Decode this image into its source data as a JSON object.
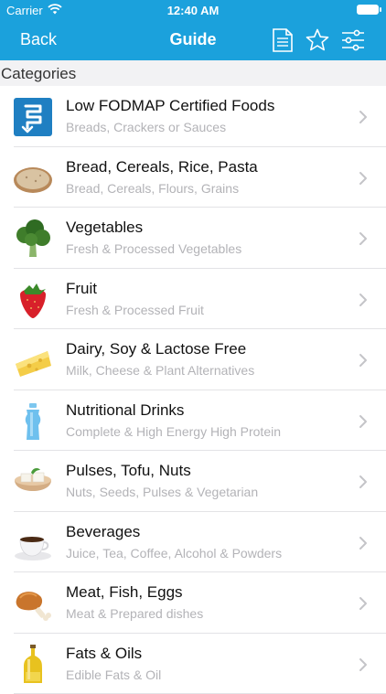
{
  "status": {
    "carrier": "Carrier",
    "time": "12:40 AM"
  },
  "nav": {
    "back_label": "Back",
    "title": "Guide"
  },
  "section_header": "Categories",
  "categories": [
    {
      "title": "Low FODMAP Certified Foods",
      "subtitle": "Breads, Crackers or Sauces",
      "icon": "certified-logo-icon"
    },
    {
      "title": "Bread, Cereals, Rice, Pasta",
      "subtitle": "Bread, Cereals, Flours, Grains",
      "icon": "bread-icon"
    },
    {
      "title": "Vegetables",
      "subtitle": "Fresh & Processed Vegetables",
      "icon": "broccoli-icon"
    },
    {
      "title": "Fruit",
      "subtitle": "Fresh & Processed Fruit",
      "icon": "strawberry-icon"
    },
    {
      "title": "Dairy, Soy & Lactose Free",
      "subtitle": "Milk, Cheese & Plant Alternatives",
      "icon": "cheese-icon"
    },
    {
      "title": "Nutritional Drinks",
      "subtitle": "Complete & High Energy High Protein",
      "icon": "drink-bottle-icon"
    },
    {
      "title": "Pulses, Tofu, Nuts",
      "subtitle": "Nuts, Seeds, Pulses & Vegetarian",
      "icon": "tofu-bowl-icon"
    },
    {
      "title": "Beverages",
      "subtitle": "Juice, Tea, Coffee, Alcohol & Powders",
      "icon": "coffee-cup-icon"
    },
    {
      "title": "Meat, Fish, Eggs",
      "subtitle": "Meat & Prepared dishes",
      "icon": "chicken-leg-icon"
    },
    {
      "title": "Fats & Oils",
      "subtitle": "Edible Fats & Oil",
      "icon": "oil-bottle-icon"
    }
  ],
  "colors": {
    "nav_bar": "#1ba1dc",
    "subtitle": "#b3b3b7",
    "section_bg": "#f2f2f4"
  }
}
